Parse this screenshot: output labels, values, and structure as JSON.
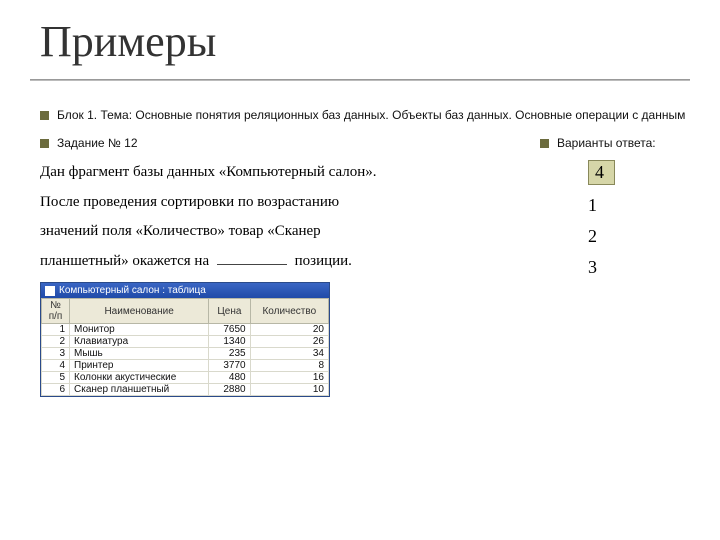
{
  "title": "Примеры",
  "topic": {
    "label": "Блок 1. Тема: Основные понятия реляционных баз данных. Объекты баз данных. Основные операции с данным"
  },
  "task": {
    "header": "Задание № 12",
    "line1_a": "Дан фрагмент базы данных «Компьютерный салон».",
    "line2": "После проведения сортировки по возрастанию",
    "line3": "значений поля «Количество» товар «Сканер",
    "line4_a": "планшетный» окажется на",
    "line4_b": "позиции."
  },
  "db": {
    "window_title": "Компьютерный салон : таблица",
    "columns": [
      "№ п/п",
      "Наименование",
      "Цена",
      "Количество"
    ],
    "rows": [
      {
        "n": "1",
        "name": "Монитор",
        "price": "7650",
        "qty": "20"
      },
      {
        "n": "2",
        "name": "Клавиатура",
        "price": "1340",
        "qty": "26"
      },
      {
        "n": "3",
        "name": "Мышь",
        "price": "235",
        "qty": "34"
      },
      {
        "n": "4",
        "name": "Принтер",
        "price": "3770",
        "qty": "8"
      },
      {
        "n": "5",
        "name": "Колонки акустические",
        "price": "480",
        "qty": "16"
      },
      {
        "n": "6",
        "name": "Сканер планшетный",
        "price": "2880",
        "qty": "10"
      }
    ]
  },
  "answers": {
    "header": "Варианты ответа:",
    "items": [
      "4",
      "1",
      "2",
      "3"
    ]
  }
}
